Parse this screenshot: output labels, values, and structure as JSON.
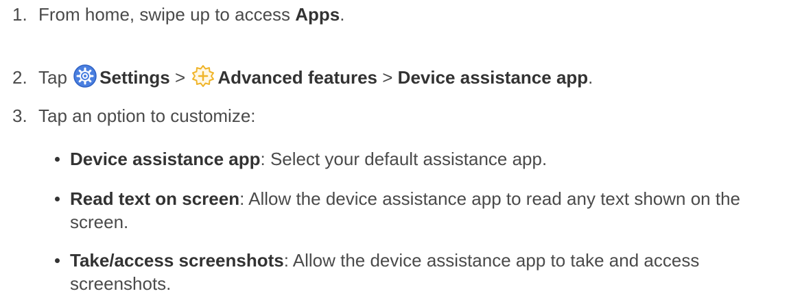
{
  "steps": [
    {
      "number": "1.",
      "prefix": "From home, swipe up to access ",
      "bold": "Apps",
      "suffix": "."
    },
    {
      "number": "2.",
      "prefix": "Tap ",
      "settings_label": "Settings",
      "sep1": " > ",
      "advanced_label": "Advanced features",
      "sep2": " > ",
      "device_label": "Device assistance app",
      "suffix": "."
    },
    {
      "number": "3.",
      "text": "Tap an option to customize:"
    }
  ],
  "options": [
    {
      "bold": "Device assistance app",
      "text": ": Select your default assistance app."
    },
    {
      "bold": "Read text on screen",
      "text": ": Allow the device assistance app to read any text shown on the screen."
    },
    {
      "bold": "Take/access screenshots",
      "text": ": Allow the device assistance app to take and access screenshots."
    }
  ],
  "icons": {
    "settings": "settings-gear-icon",
    "advanced": "advanced-features-icon"
  },
  "colors": {
    "text": "#4a4a4a",
    "bold": "#333333",
    "settings_icon_bg": "#4a7fe0",
    "advanced_icon": "#f0b429"
  }
}
